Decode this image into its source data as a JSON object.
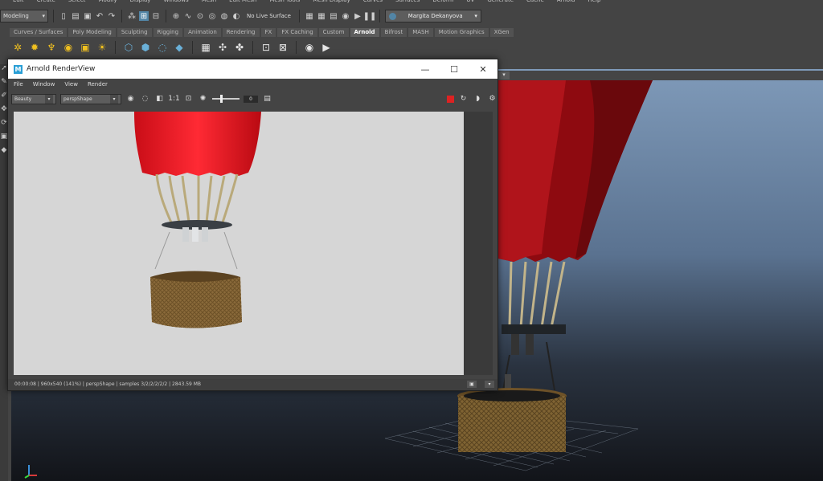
{
  "main_menu": [
    "Edit",
    "Create",
    "Select",
    "Modify",
    "Display",
    "Windows",
    "Mesh",
    "Edit Mesh",
    "Mesh Tools",
    "Mesh Display",
    "Curves",
    "Surfaces",
    "Deform",
    "UV",
    "Generate",
    "Cache",
    "Arnold",
    "Help"
  ],
  "status_line": {
    "mode": "Modeling",
    "live_surface": "No Live Surface",
    "user_name": "Margita Dekanyova"
  },
  "shelf": {
    "tabs": [
      "Curves / Surfaces",
      "Poly Modeling",
      "Sculpting",
      "Rigging",
      "Animation",
      "Rendering",
      "FX",
      "FX Caching",
      "Custom",
      "Arnold",
      "Bifrost",
      "MASH",
      "Motion Graphics",
      "XGen"
    ],
    "active_tab": "Arnold"
  },
  "render_view": {
    "title": "Arnold RenderView",
    "logo_letter": "M",
    "menu": [
      "File",
      "Window",
      "View",
      "Render"
    ],
    "aov": "Beauty",
    "camera": "perspShape",
    "ratio_label": "1:1",
    "exposure": "0",
    "status_text": "00:00:08 | 960x540 (141%) | perspShape  | samples 3/2/2/2/2/2 | 2843.59 MB"
  },
  "colors": {
    "maya_accent": "#5285a6",
    "balloon_red": "#d8101c",
    "basket_brown": "#8a6a3a",
    "stop_red": "#dd2222"
  }
}
